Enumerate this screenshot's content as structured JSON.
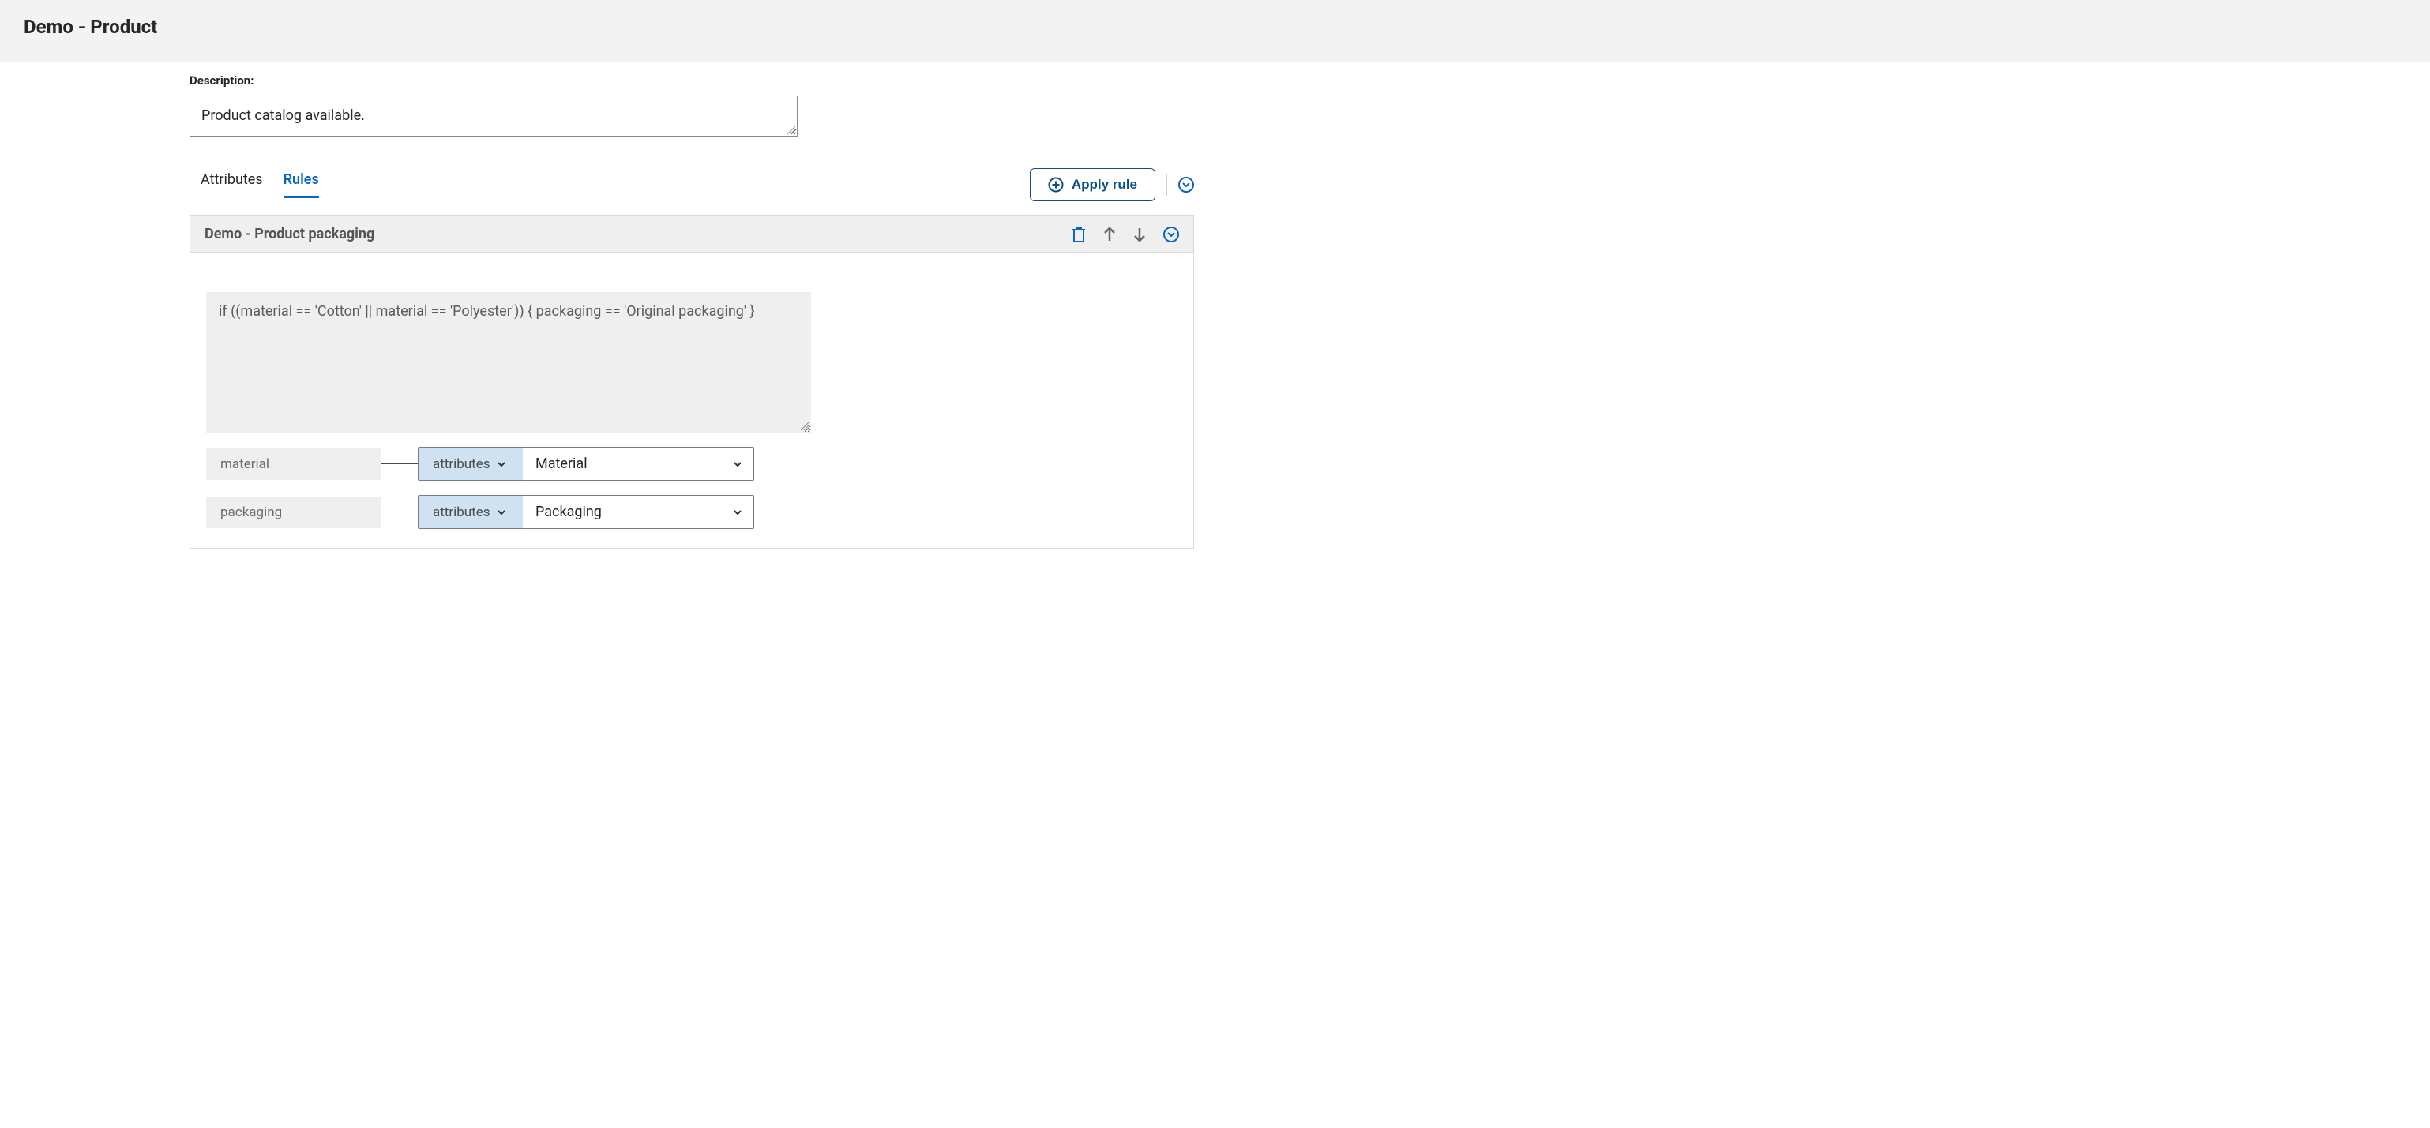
{
  "header": {
    "title": "Demo - Product"
  },
  "description": {
    "label": "Description:",
    "value": "Product catalog available."
  },
  "tabs": {
    "items": [
      {
        "label": "Attributes",
        "active": false
      },
      {
        "label": "Rules",
        "active": true
      }
    ],
    "apply_rule_label": "Apply rule"
  },
  "rule": {
    "title": "Demo - Product packaging",
    "expression": "if ((material == 'Cotton' || material == 'Polyester')) { packaging == 'Original packaging' }",
    "mappings": [
      {
        "var": "material",
        "source": "attributes",
        "value": "Material"
      },
      {
        "var": "packaging",
        "source": "attributes",
        "value": "Packaging"
      }
    ]
  }
}
